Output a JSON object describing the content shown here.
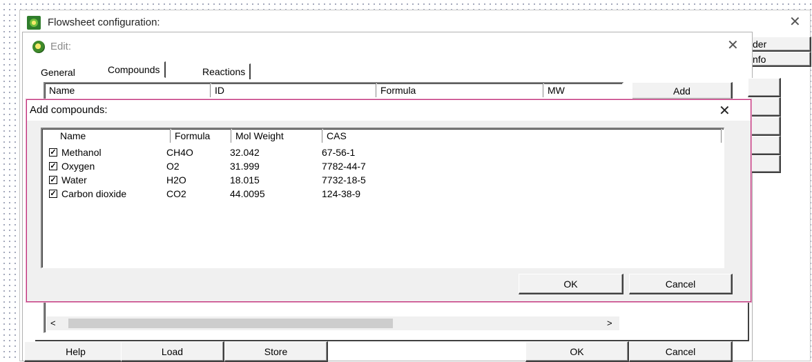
{
  "flowsheet": {
    "title": "Flowsheet configuration:",
    "right_tabs": [
      "der",
      "nfo"
    ]
  },
  "edit": {
    "title": "Edit:",
    "tabs": [
      "General",
      "Compounds",
      "Reactions"
    ],
    "columns": [
      "Name",
      "ID",
      "Formula",
      "MW"
    ],
    "side_buttons": [
      "Add",
      "",
      "",
      "",
      ""
    ],
    "bottom_buttons": {
      "help": "Help",
      "load": "Load",
      "store": "Store",
      "ok": "OK",
      "cancel": "Cancel"
    },
    "scroll_left": "<",
    "scroll_right": ">"
  },
  "add_compounds": {
    "title": "Add compounds:",
    "columns": [
      "Name",
      "Formula",
      "Mol Weight",
      "CAS"
    ],
    "rows": [
      {
        "checked": true,
        "name": "Methanol",
        "formula": "CH4O",
        "mw": "32.042",
        "cas": "67-56-1"
      },
      {
        "checked": true,
        "name": "Oxygen",
        "formula": "O2",
        "mw": "31.999",
        "cas": "7782-44-7"
      },
      {
        "checked": true,
        "name": "Water",
        "formula": "H2O",
        "mw": "18.015",
        "cas": "7732-18-5"
      },
      {
        "checked": true,
        "name": "Carbon dioxide",
        "formula": "CO2",
        "mw": "44.0095",
        "cas": "124-38-9"
      }
    ],
    "ok": "OK",
    "cancel": "Cancel"
  },
  "colors": {
    "accent_border": "#c0307a"
  }
}
